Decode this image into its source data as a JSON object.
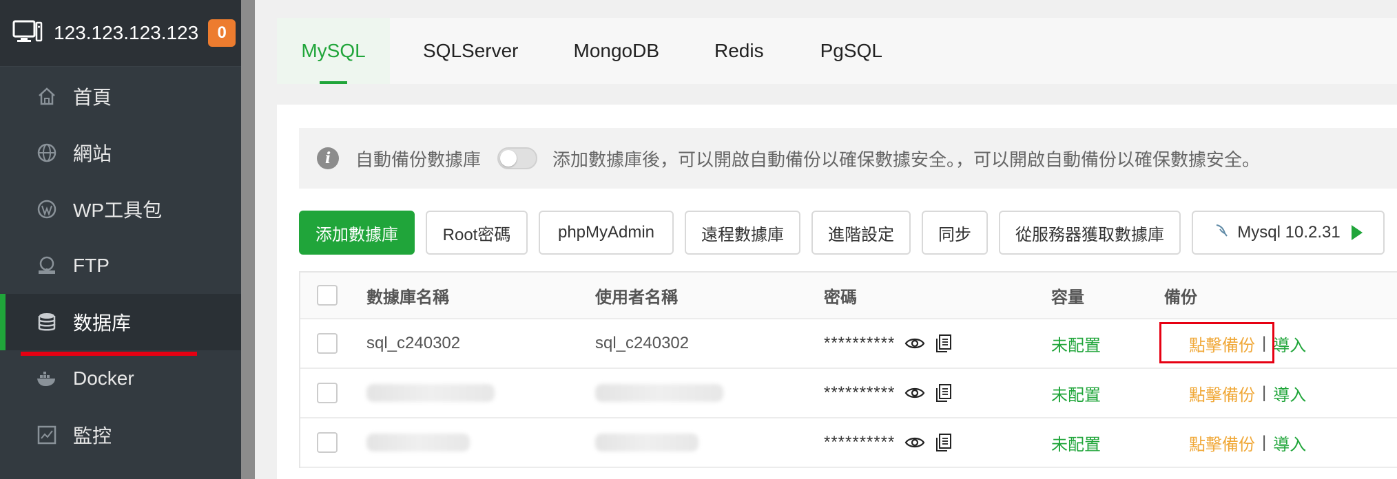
{
  "header": {
    "host": "123.123.123.123",
    "badge": "0"
  },
  "sidebar": {
    "items": [
      {
        "label": "首頁",
        "icon": "home-icon"
      },
      {
        "label": "網站",
        "icon": "globe-icon"
      },
      {
        "label": "WP工具包",
        "icon": "wordpress-icon"
      },
      {
        "label": "FTP",
        "icon": "ftp-icon"
      },
      {
        "label": "数据库",
        "icon": "database-icon",
        "active": true
      },
      {
        "label": "Docker",
        "icon": "docker-icon"
      },
      {
        "label": "監控",
        "icon": "monitor-chart-icon"
      }
    ]
  },
  "tabs": [
    {
      "label": "MySQL",
      "active": true
    },
    {
      "label": "SQLServer"
    },
    {
      "label": "MongoDB"
    },
    {
      "label": "Redis"
    },
    {
      "label": "PgSQL"
    }
  ],
  "notice": {
    "label": "自動備份數據庫",
    "message": "添加數據庫後，可以開啟自動備份以確保數據安全。，可以開啟自動備份以確保數據安全。"
  },
  "toolbar": {
    "add_db": "添加數據庫",
    "root_password": "Root密碼",
    "phpmyadmin": "phpMyAdmin",
    "remote_db": "遠程數據庫",
    "advanced": "進階設定",
    "sync": "同步",
    "get_from_server": "從服務器獲取數據庫",
    "mysql_version": "Mysql 10.2.31"
  },
  "table": {
    "headers": {
      "db_name": "數據庫名稱",
      "username": "使用者名稱",
      "password": "密碼",
      "capacity": "容量",
      "backup": "備份"
    },
    "rows": [
      {
        "db_name": "sql_c240302",
        "username": "sql_c240302",
        "password": "**********",
        "capacity": "未配置",
        "backup": "點擊備份",
        "import": "導入"
      },
      {
        "db_name": "",
        "username": "",
        "password": "**********",
        "capacity": "未配置",
        "backup": "點擊備份",
        "import": "導入"
      },
      {
        "db_name": "",
        "username": "",
        "password": "**********",
        "capacity": "未配置",
        "backup": "點擊備份",
        "import": "導入"
      }
    ],
    "separator": "|"
  },
  "colors": {
    "accent": "#20a53a",
    "warning": "#f0a838",
    "highlight": "#e60012",
    "sidebar_bg": "#333a40"
  }
}
